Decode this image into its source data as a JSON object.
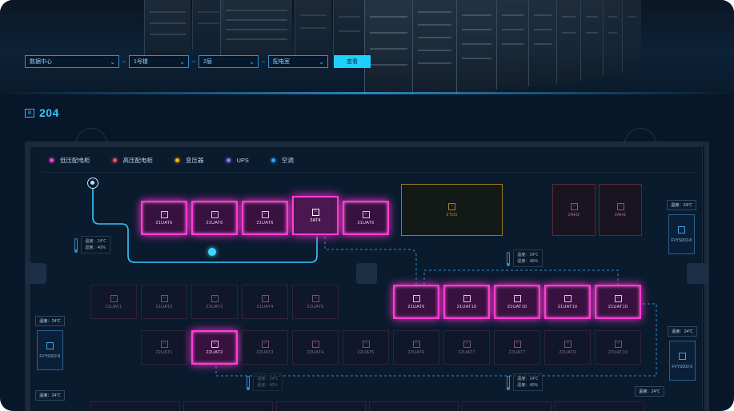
{
  "filters": {
    "datacenter": "数据中心",
    "building": "1号楼",
    "floor": "2层",
    "room_type": "配电室",
    "query_button": "查看"
  },
  "room": {
    "icon": "room-icon",
    "number": "204"
  },
  "legend": [
    {
      "label": "低压配电柜",
      "color": "#ff3fd2"
    },
    {
      "label": "高压配电柜",
      "color": "#ff4a55"
    },
    {
      "label": "变压器",
      "color": "#ffb300"
    },
    {
      "label": "UPS",
      "color": "#9b6bff"
    },
    {
      "label": "空调",
      "color": "#22a8ff"
    }
  ],
  "cabinets_row1": [
    "21UAT6",
    "21UAT6",
    "21UAT6",
    "2AT4",
    "21UAT6"
  ],
  "transformer": "2TD1",
  "hv_cabinets": [
    "2AH2",
    "2AH1"
  ],
  "cabinets_row2_left": [
    "21UAT1",
    "21UAT2",
    "21UAT3",
    "21UAT4",
    "21UAT5"
  ],
  "cabinets_row2_right": [
    "21UAT6",
    "21UAT10",
    "21UAT10",
    "21UAT10",
    "21UAT10"
  ],
  "cabinets_row3": [
    "22UAT1",
    "22UAT2",
    "22UAT3",
    "22UAT4",
    "22UAT5",
    "22UAT6",
    "22UAT7",
    "22UAT7",
    "22UAT9",
    "22UAT10"
  ],
  "sensors": {
    "temp_label": "温度：24℃",
    "humidity_label": "湿度：40%"
  },
  "ac_units": {
    "left": "FVYS002-8",
    "right_top": "FVYS002-8",
    "right_mid": "FVYS002-5",
    "temp_tag": "温度：24℃"
  }
}
